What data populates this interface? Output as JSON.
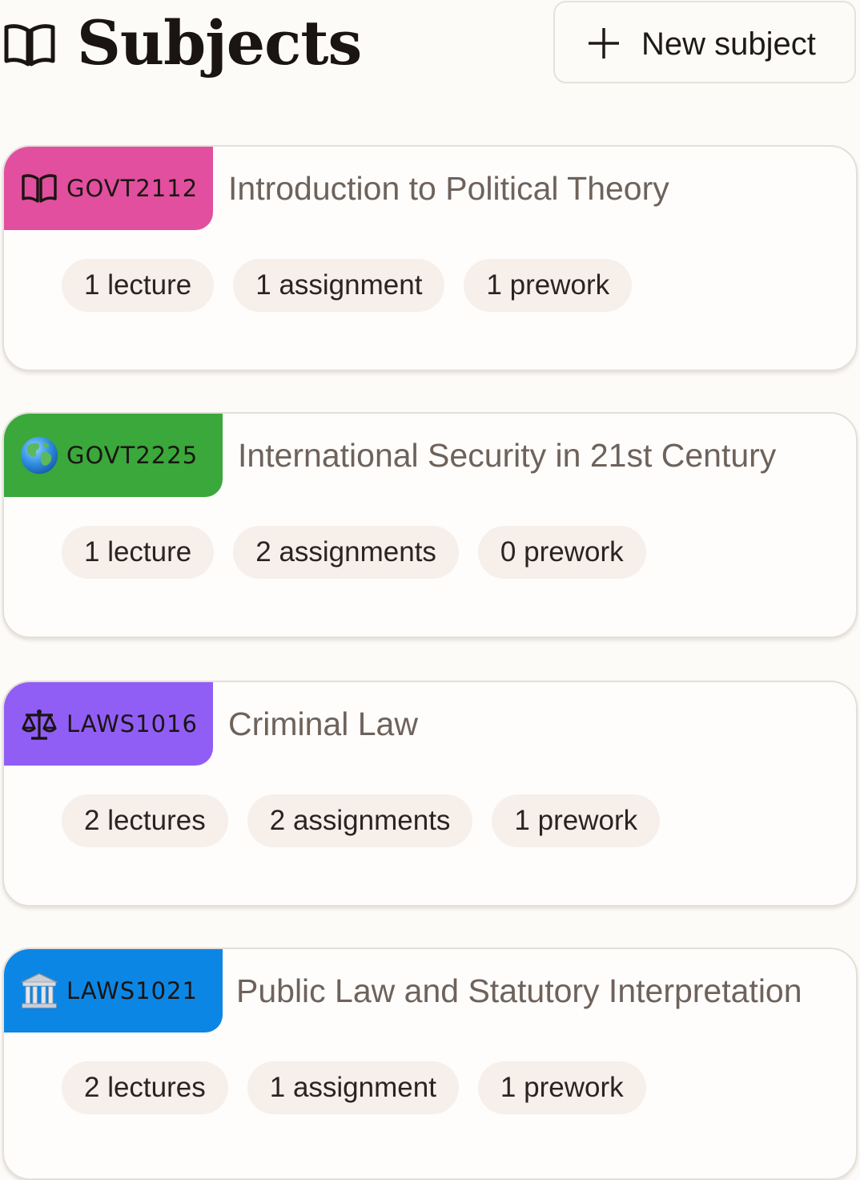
{
  "header": {
    "title": "Subjects",
    "icon": "open-book-icon",
    "new_button_label": "New subject",
    "new_button_icon": "plus-icon"
  },
  "subjects": [
    {
      "code": "GOVT2112",
      "name": "Introduction to Political Theory",
      "icon": "open-book-icon",
      "color": "#e24f9f",
      "chips": [
        "1 lecture",
        "1 assignment",
        "1 prework"
      ]
    },
    {
      "code": "GOVT2225",
      "name": "International Security in 21st Century",
      "icon": "globe-icon",
      "color": "#3aa83a",
      "chips": [
        "1 lecture",
        "2 assignments",
        "0 prework"
      ]
    },
    {
      "code": "LAWS1016",
      "name": "Criminal Law",
      "icon": "balance-scale-icon",
      "color": "#915ef5",
      "chips": [
        "2 lectures",
        "2 assignments",
        "1 prework"
      ]
    },
    {
      "code": "LAWS1021",
      "name": "Public Law and Statutory Interpretation",
      "icon": "classical-building-icon",
      "color": "#0c86e4",
      "chips": [
        "2 lectures",
        "1 assignment",
        "1 prework"
      ]
    }
  ]
}
